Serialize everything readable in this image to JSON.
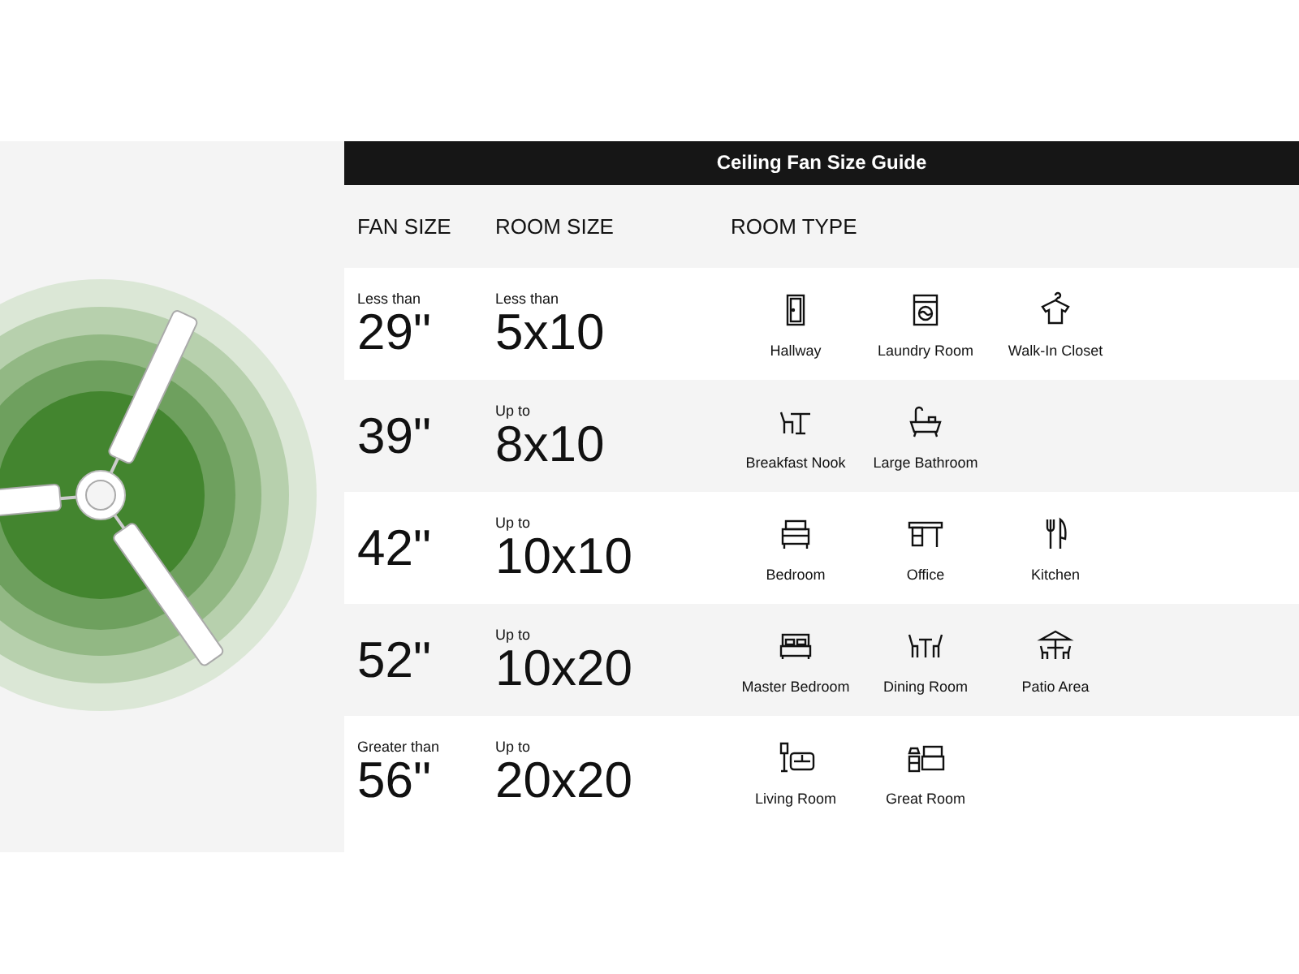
{
  "title": "Ceiling Fan Size Guide",
  "columns": [
    "FAN SIZE",
    "ROOM SIZE",
    "ROOM TYPE"
  ],
  "rows": [
    {
      "fan_prefix": "Less than",
      "fan_size": "29\"",
      "room_prefix": "Less than",
      "room_size": "5x10",
      "room_types": [
        "Hallway",
        "Laundry Room",
        "Walk-In Closet"
      ]
    },
    {
      "fan_size": "39\"",
      "room_prefix": "Up to",
      "room_size": "8x10",
      "room_types": [
        "Breakfast Nook",
        "Large Bathroom"
      ]
    },
    {
      "fan_size": "42\"",
      "room_prefix": "Up to",
      "room_size": "10x10",
      "room_types": [
        "Bedroom",
        "Office",
        "Kitchen"
      ]
    },
    {
      "fan_size": "52\"",
      "room_prefix": "Up to",
      "room_size": "10x20",
      "room_types": [
        "Master Bedroom",
        "Dining Room",
        "Patio Area"
      ]
    },
    {
      "fan_prefix": "Greater than",
      "fan_size": "56\"",
      "room_prefix": "Up to",
      "room_size": "20x20",
      "room_types": [
        "Living Room",
        "Great Room"
      ]
    }
  ]
}
